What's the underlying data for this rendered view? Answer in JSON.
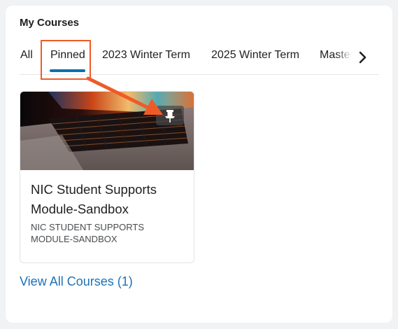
{
  "widget": {
    "title": "My Courses",
    "tabs": [
      {
        "label": "All",
        "selected": false
      },
      {
        "label": "Pinned",
        "selected": true
      },
      {
        "label": "2023 Winter Term",
        "selected": false
      },
      {
        "label": "2025 Winter Term",
        "selected": false
      },
      {
        "label": "Master",
        "selected": false
      }
    ],
    "view_all_label": "View All Courses (1)"
  },
  "course": {
    "title": "NIC Student Supports Module-Sandbox",
    "code": "NIC STUDENT SUPPORTS MODULE-SANDBOX",
    "pinned": true
  },
  "icons": {
    "scroll_right": "chevron-right-icon",
    "pin": "pin-icon"
  },
  "colors": {
    "accent": "#0c6fb0",
    "link": "#1d71b8",
    "annotation": "#ef5b27"
  }
}
